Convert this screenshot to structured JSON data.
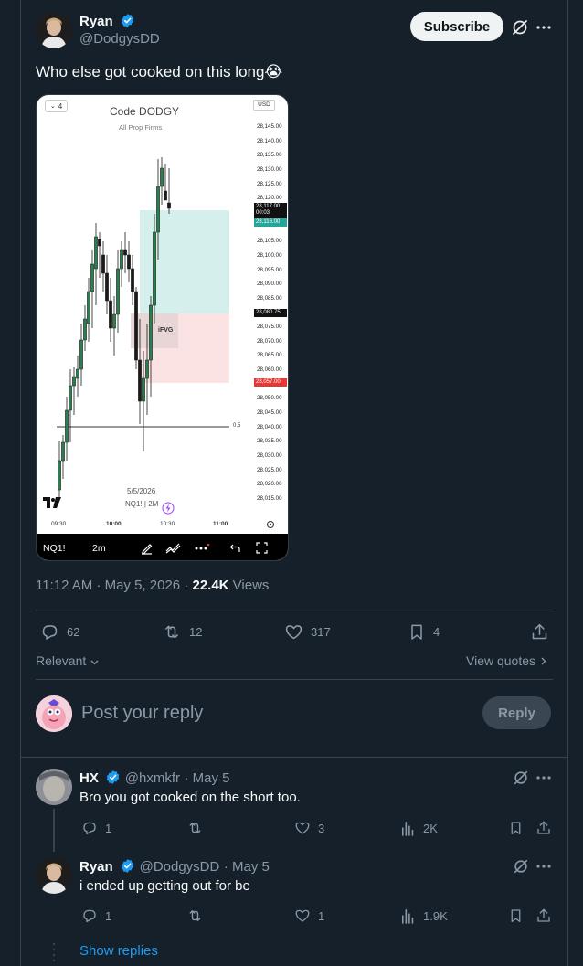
{
  "post": {
    "author_name": "Ryan",
    "author_handle": "@DodgysDD",
    "subscribe_label": "Subscribe",
    "text": "Who else got cooked on this long😭",
    "timestamp": "11:12 AM · May 5, 2026 · ",
    "views_count": "22.4K",
    "views_label": " Views",
    "replies": "62",
    "reposts": "12",
    "likes": "317",
    "bookmarks": "4"
  },
  "chart_image": {
    "interval_badge": "4",
    "currency": "USD",
    "watermark_title": "Code DODGY",
    "watermark_sub": "All Prop Firms",
    "prices": [
      "28,145.00",
      "28,140.00",
      "28,135.00",
      "28,130.00",
      "28,125.00",
      "28,120.00",
      "",
      "",
      "28,105.00",
      "28,100.00",
      "28,095.00",
      "28,090.00",
      "28,085.00",
      "",
      "28,075.00",
      "28,070.00",
      "28,065.00",
      "28,060.00",
      "",
      "28,050.00",
      "28,045.00",
      "28,040.00",
      "28,035.00",
      "28,030.00",
      "28,025.00",
      "28,020.00",
      "28,015.00"
    ],
    "price_current": "28,117.00",
    "price_timer": "00:03",
    "price_tp": "28,116.00",
    "price_entry": "28,080.75",
    "price_sl": "28,057.00",
    "fvg_label": "iFVG",
    "level_label": "0.5",
    "date_label": "5/5/2026",
    "symbol_label": "NQ1! | 2M",
    "time_labels": [
      "09:30",
      "10:00",
      "10:30",
      "11:00"
    ],
    "toolbar_symbol": "NQ1!",
    "toolbar_interval": "2m",
    "colors": {
      "bull": "#2e7d4f",
      "tp_zone": "#d5efec",
      "sl_zone": "#fbe3e3",
      "tp": "#26a69a",
      "sl": "#e53935"
    }
  },
  "controls": {
    "sort_label": "Relevant",
    "view_quotes": "View quotes",
    "reply_placeholder": "Post your reply",
    "reply_button": "Reply"
  },
  "replies": [
    {
      "name": "HX",
      "handle": "@hxmkfr",
      "date": "· May 5",
      "text": "Bro you got cooked on the short too.",
      "replies": "1",
      "reposts": "",
      "likes": "3",
      "views": "2K"
    },
    {
      "name": "Ryan",
      "handle": "@DodgysDD",
      "date": "· May 5",
      "text": "i ended up getting out for be",
      "replies": "1",
      "reposts": "",
      "likes": "1",
      "views": "1.9K"
    }
  ],
  "show_replies": "Show replies"
}
